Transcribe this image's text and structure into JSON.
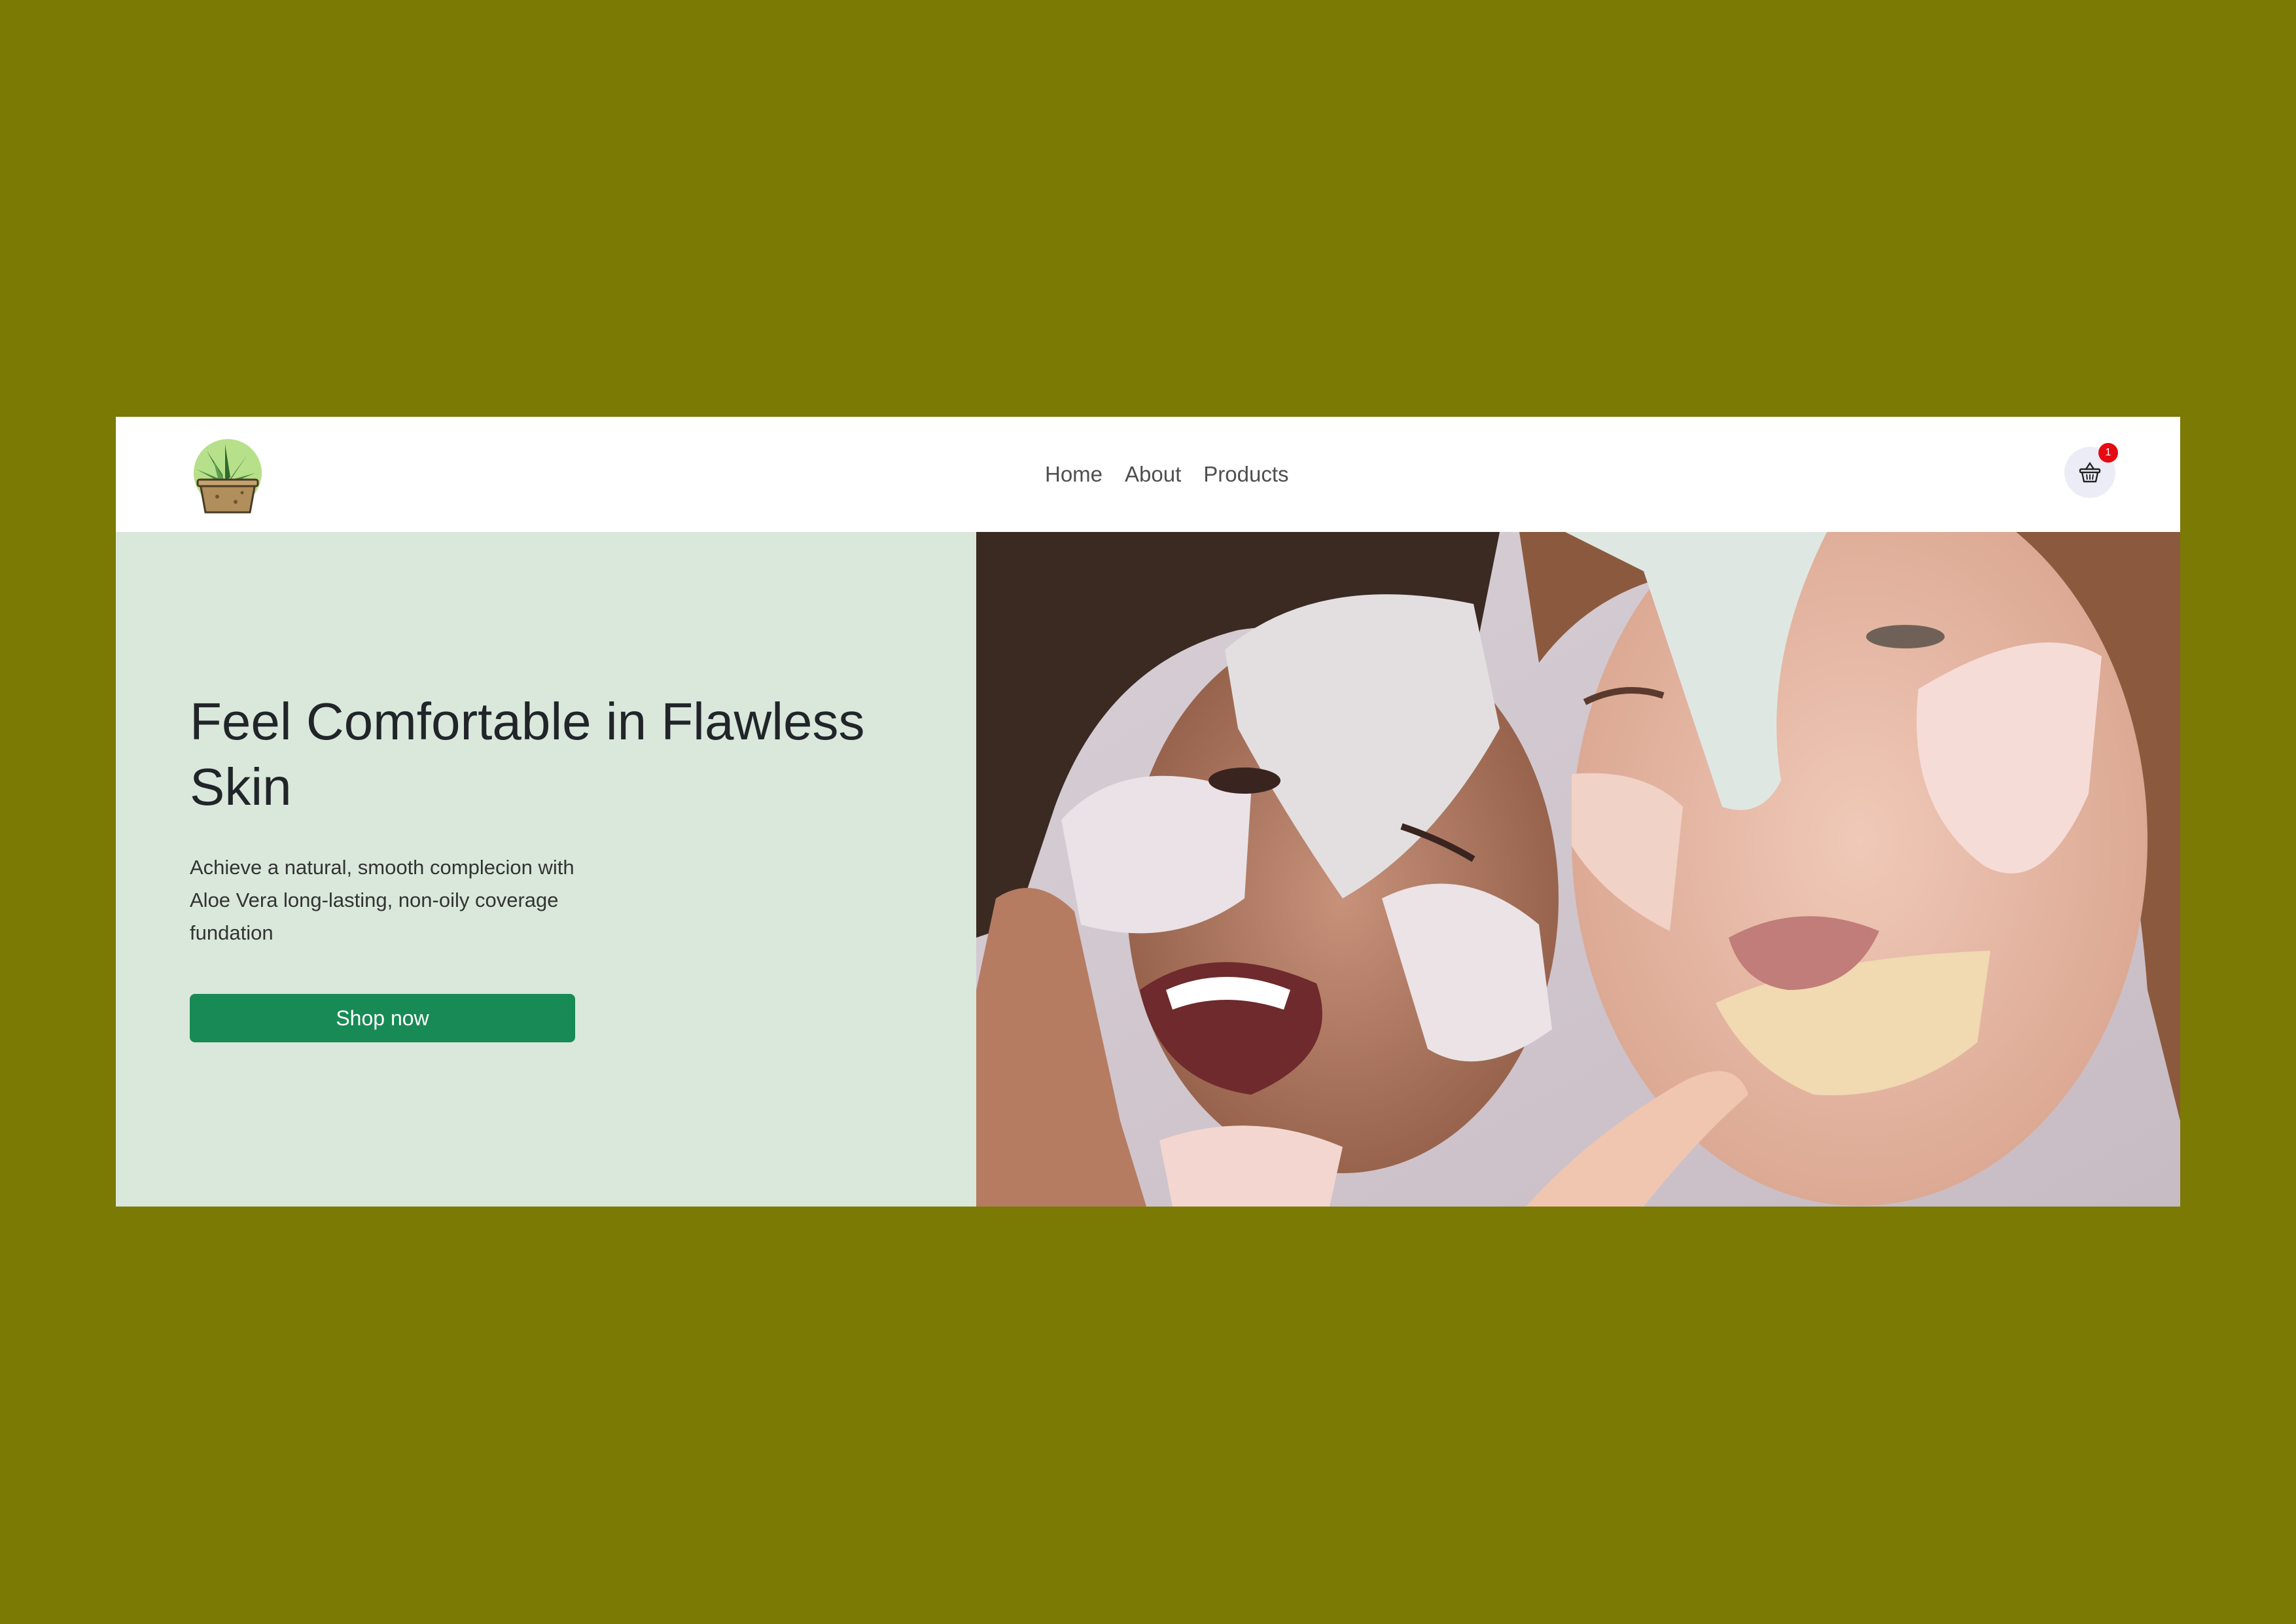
{
  "nav": {
    "logo_icon": "aloe-plant-logo",
    "links": [
      {
        "label": "Home"
      },
      {
        "label": "About"
      },
      {
        "label": "Products"
      }
    ],
    "cart_icon": "basket-icon",
    "cart_count": "1"
  },
  "hero": {
    "title": "Feel Comfortable in Flawless Skin",
    "description": "Achieve a natural, smooth complecion with Aloe Vera long-lasting, non-oily coverage fundation",
    "cta_label": "Shop now",
    "image": "two-women-with-face-masks-photo"
  },
  "colors": {
    "page_background": "#7a7a05",
    "hero_panel": "#d9e8db",
    "button": "#188a55",
    "badge": "#e60a12"
  }
}
